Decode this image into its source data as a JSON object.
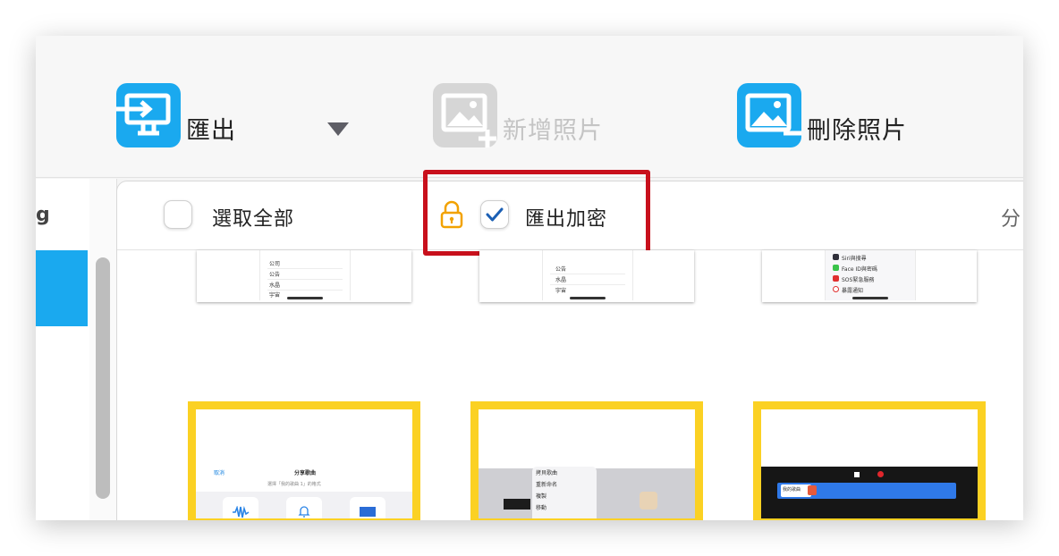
{
  "toolbar": {
    "export": {
      "label": "匯出",
      "icon": "export-screen-icon",
      "color": "#1aa9ef"
    },
    "dropdown": {
      "icon": "dropdown-triangle-icon"
    },
    "add_photo": {
      "label": "新增照片",
      "icon": "add-photo-icon",
      "disabled": true
    },
    "delete_photo": {
      "label": "刪除照片",
      "icon": "delete-photo-icon",
      "color": "#1aa9ef"
    }
  },
  "sidebar": {
    "fragment_text": "g"
  },
  "panel_header": {
    "select_all": {
      "label": "選取全部",
      "checked": false
    },
    "encrypt_export": {
      "label": "匯出加密",
      "checked": true,
      "icon": "lock-icon",
      "lock_color": "#f2a200"
    },
    "cut_off_label": "分"
  },
  "highlight_color": "#c8101c",
  "thumbnails_top": [
    {
      "items": [
        "公司",
        "公告",
        "水晶",
        "宇宙"
      ]
    },
    {
      "items": [
        "公告",
        "水晶",
        "宇宙"
      ]
    },
    {
      "items": [
        "Siri與搜尋",
        "Face ID與密碼",
        "SOS緊急服務",
        "暴露通知"
      ]
    }
  ],
  "thumbnails_bottom": [
    {
      "header_left": "取消",
      "title": "分享歌曲",
      "subtitle": "選擇「我的歌曲 1」的格式"
    },
    {
      "menu": [
        "拷貝歌曲",
        "重新命名",
        "複製",
        "移動"
      ]
    },
    {
      "clip_label": "我的歌曲"
    }
  ],
  "selection_color": "#fbd123"
}
